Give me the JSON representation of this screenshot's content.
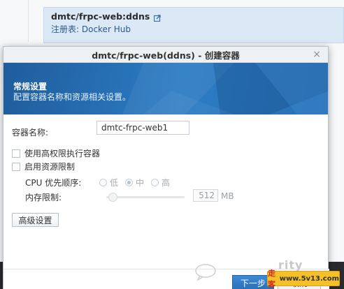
{
  "background": {
    "card": {
      "title": "dmtc/frpc-web:ddns",
      "registry": "注册表: Docker Hub"
    }
  },
  "dialog": {
    "title": "dmtc/frpc-web(ddns) - 创建容器",
    "close_label": "×",
    "banner": {
      "title": "常规设置",
      "description": "配置容器名称和资源相关设置。"
    },
    "container_name": {
      "label": "容器名称:",
      "value": "dmtc-frpc-web1"
    },
    "privileged": {
      "label": "使用高权限执行容器",
      "checked": false
    },
    "resource_limit": {
      "label": "启用资源限制",
      "checked": false
    },
    "cpu_priority": {
      "label": "CPU 优先顺序:",
      "options": [
        "低",
        "中",
        "高"
      ],
      "selected": "中"
    },
    "memory_limit": {
      "label": "内存限制:",
      "value": "512",
      "unit": "MB",
      "slider_fraction": 0.05
    },
    "advanced_button": "高级设置",
    "footer": {
      "next_label": "下一步",
      "cancel_label": "取消"
    }
  },
  "watermark": {
    "brand": "走客",
    "url": "www.5v13.com",
    "logo_text": "rity"
  },
  "colors": {
    "banner": "#2c7cc4",
    "accent": "#2a6fb8",
    "card_bg": "#dbe8f6",
    "watermark_badge": "#f6c02a"
  }
}
